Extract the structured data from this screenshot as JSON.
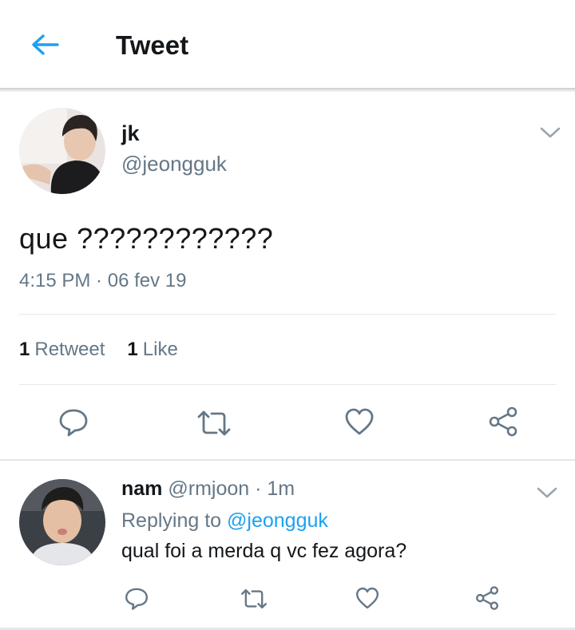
{
  "header": {
    "title": "Tweet",
    "back_icon": "back-arrow-icon",
    "accent_color": "#1da1f2"
  },
  "tweet": {
    "name": "jk",
    "handle": "@jeongguk",
    "text": "que ????????????",
    "time": "4:15 PM",
    "separator": " · ",
    "date": "06 fev 19",
    "retweets": {
      "count": "1",
      "label": "Retweet"
    },
    "likes": {
      "count": "1",
      "label": "Like"
    },
    "actions": [
      "reply-icon",
      "retweet-icon",
      "like-icon",
      "share-icon"
    ]
  },
  "reply": {
    "name": "nam",
    "handle": "@rmjoon",
    "separator": " · ",
    "time": "1m",
    "replying_label": "Replying to",
    "replying_to": "@jeongguk",
    "text": "qual foi a merda q vc fez agora?",
    "actions": [
      "reply-icon",
      "retweet-icon",
      "like-icon",
      "share-icon"
    ]
  },
  "colors": {
    "secondary_text": "#657786",
    "primary_text": "#14171a",
    "divider": "#e1e8ed"
  }
}
